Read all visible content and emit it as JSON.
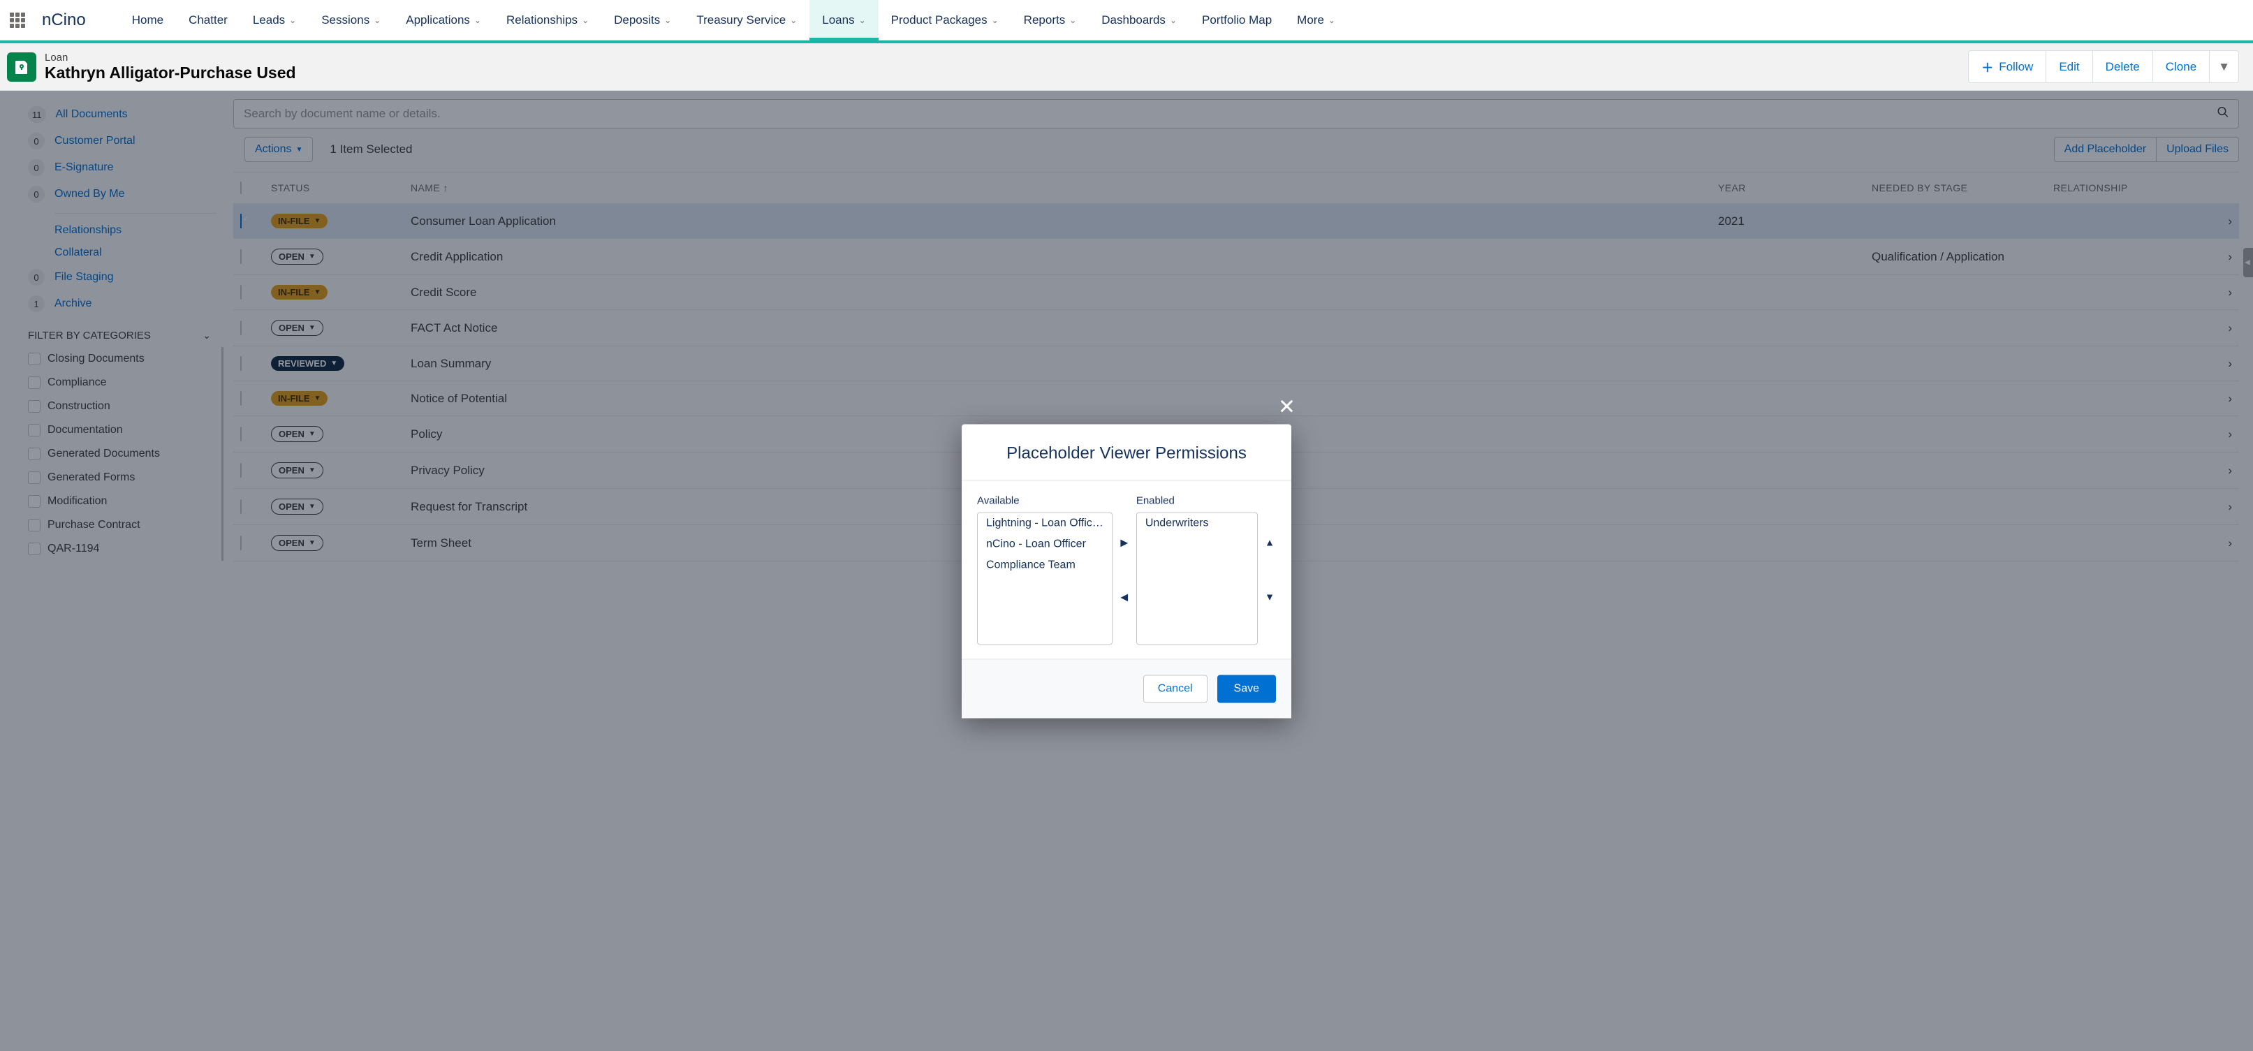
{
  "brand": "nCino",
  "nav": {
    "items": [
      {
        "label": "Home",
        "dropdown": false
      },
      {
        "label": "Chatter",
        "dropdown": false
      },
      {
        "label": "Leads",
        "dropdown": true
      },
      {
        "label": "Sessions",
        "dropdown": true
      },
      {
        "label": "Applications",
        "dropdown": true
      },
      {
        "label": "Relationships",
        "dropdown": true
      },
      {
        "label": "Deposits",
        "dropdown": true
      },
      {
        "label": "Treasury Service",
        "dropdown": true
      },
      {
        "label": "Loans",
        "dropdown": true,
        "active": true
      },
      {
        "label": "Product Packages",
        "dropdown": true
      },
      {
        "label": "Reports",
        "dropdown": true
      },
      {
        "label": "Dashboards",
        "dropdown": true
      },
      {
        "label": "Portfolio Map",
        "dropdown": false
      },
      {
        "label": "More",
        "dropdown": true
      }
    ]
  },
  "record": {
    "object_label": "Loan",
    "title": "Kathryn Alligator-Purchase Used",
    "actions": {
      "follow": "Follow",
      "edit": "Edit",
      "delete": "Delete",
      "clone": "Clone"
    }
  },
  "sidebar": {
    "categories": [
      {
        "count": "11",
        "label": "All Documents"
      },
      {
        "count": "0",
        "label": "Customer Portal"
      },
      {
        "count": "0",
        "label": "E-Signature"
      },
      {
        "count": "0",
        "label": "Owned By Me"
      }
    ],
    "subnav": [
      {
        "label": "Relationships"
      },
      {
        "label": "Collateral"
      }
    ],
    "categories2": [
      {
        "count": "0",
        "label": "File Staging"
      },
      {
        "count": "1",
        "label": "Archive"
      }
    ],
    "filter_heading": "FILTER BY CATEGORIES",
    "filters": [
      "Closing Documents",
      "Compliance",
      "Construction",
      "Documentation",
      "Generated Documents",
      "Generated Forms",
      "Modification",
      "Purchase Contract",
      "QAR-1194"
    ]
  },
  "docs": {
    "search_placeholder": "Search by document name or details.",
    "actions_label": "Actions",
    "selected_text": "1 Item Selected",
    "add_placeholder_label": "Add Placeholder",
    "upload_label": "Upload Files",
    "columns": {
      "status": "STATUS",
      "name": "NAME",
      "year": "YEAR",
      "needed": "NEEDED BY STAGE",
      "relationship": "RELATIONSHIP"
    },
    "rows": [
      {
        "selected": true,
        "status": "IN-FILE",
        "status_style": "in_file",
        "name": "Consumer Loan Application",
        "year": "2021",
        "needed": "",
        "relationship": ""
      },
      {
        "selected": false,
        "status": "OPEN",
        "status_style": "open",
        "name": "Credit Application",
        "year": "",
        "needed": "Qualification / Application",
        "relationship": ""
      },
      {
        "selected": false,
        "status": "IN-FILE",
        "status_style": "in_file",
        "name": "Credit Score",
        "year": "",
        "needed": "",
        "relationship": ""
      },
      {
        "selected": false,
        "status": "OPEN",
        "status_style": "open",
        "name": "FACT Act Notice",
        "year": "",
        "needed": "",
        "relationship": ""
      },
      {
        "selected": false,
        "status": "REVIEWED",
        "status_style": "reviewed",
        "name": "Loan Summary",
        "year": "",
        "needed": "",
        "relationship": ""
      },
      {
        "selected": false,
        "status": "IN-FILE",
        "status_style": "in_file",
        "name": "Notice of Potential",
        "year": "",
        "needed": "",
        "relationship": ""
      },
      {
        "selected": false,
        "status": "OPEN",
        "status_style": "open",
        "name": "Policy",
        "year": "",
        "needed": "",
        "relationship": ""
      },
      {
        "selected": false,
        "status": "OPEN",
        "status_style": "open",
        "name": "Privacy Policy",
        "year": "",
        "needed": "",
        "relationship": ""
      },
      {
        "selected": false,
        "status": "OPEN",
        "status_style": "open",
        "name": "Request for Transcript",
        "year": "",
        "needed": "",
        "relationship": ""
      },
      {
        "selected": false,
        "status": "OPEN",
        "status_style": "open",
        "name": "Term Sheet",
        "year": "",
        "needed": "",
        "relationship": ""
      }
    ]
  },
  "modal": {
    "title": "Placeholder Viewer Permissions",
    "available_label": "Available",
    "enabled_label": "Enabled",
    "available": [
      "Lightning - Loan Offic…",
      "nCino - Loan Officer",
      "Compliance Team"
    ],
    "enabled": [
      "Underwriters"
    ],
    "cancel": "Cancel",
    "save": "Save"
  }
}
